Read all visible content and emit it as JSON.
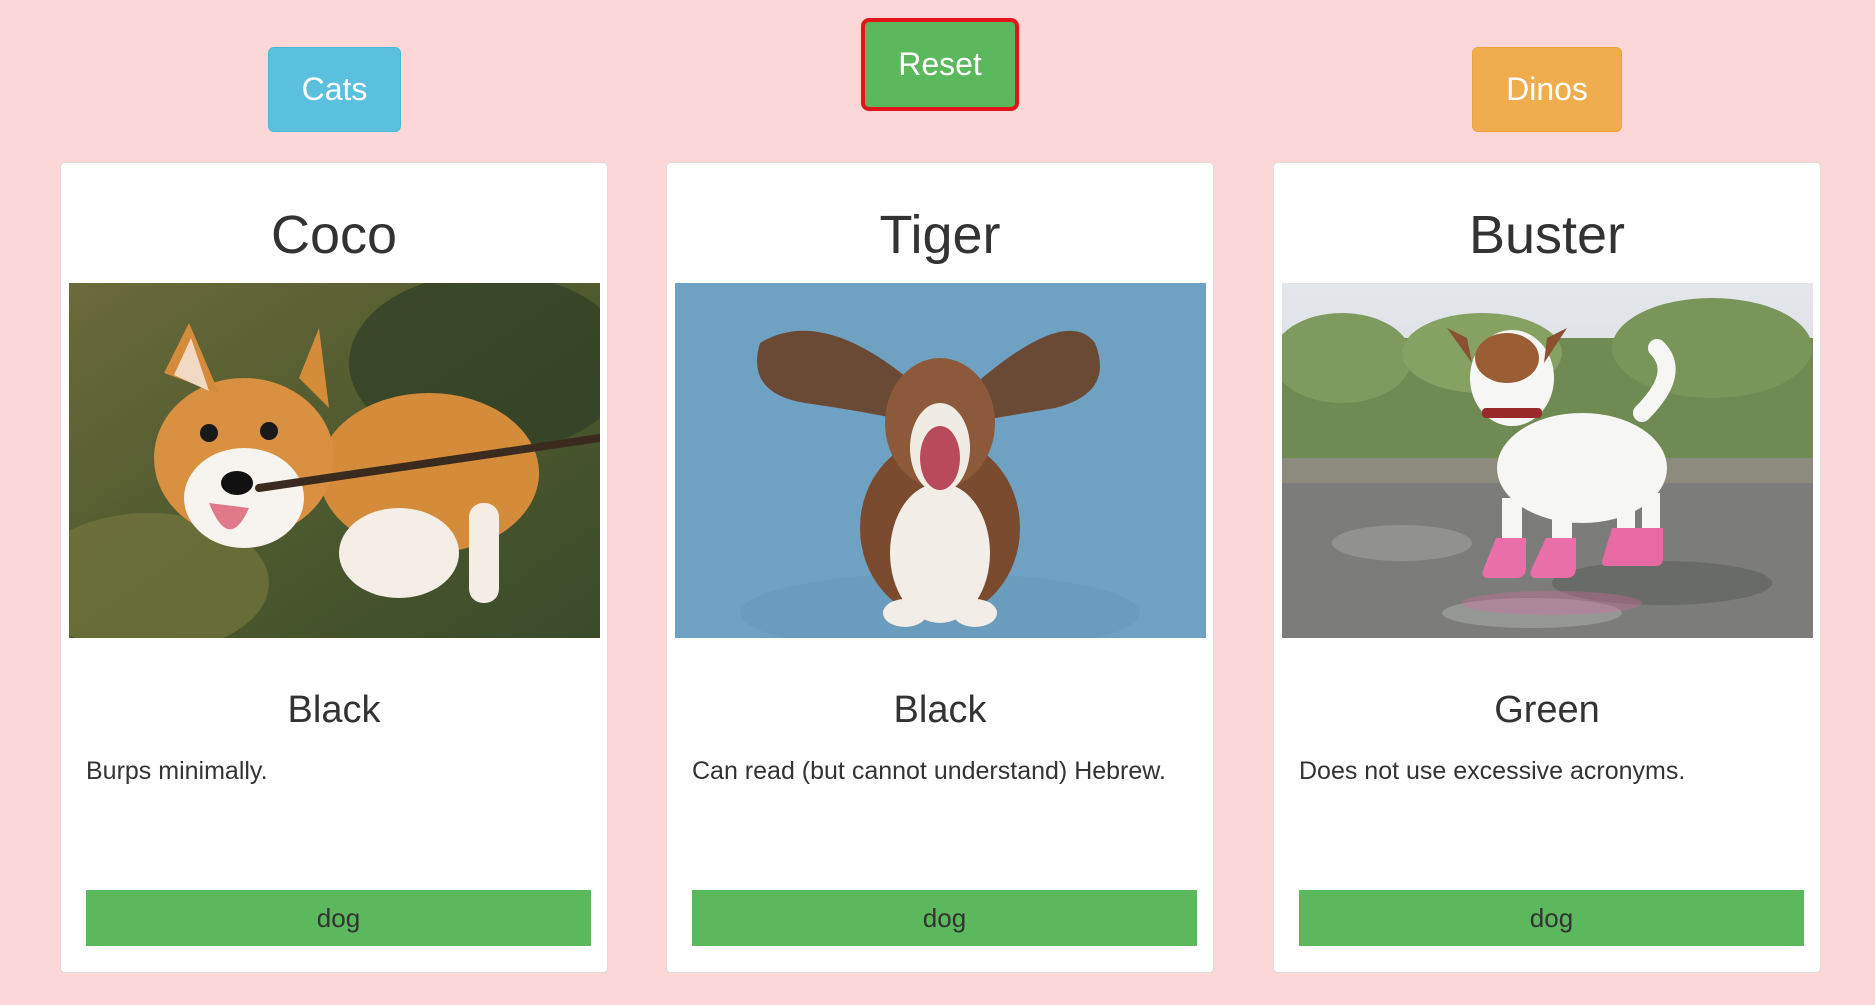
{
  "filters": {
    "cats_label": "Cats",
    "reset_label": "Reset",
    "dinos_label": "Dinos"
  },
  "colors": {
    "background": "#fcd7d8",
    "cats": "#5bc0de",
    "reset": "#5cb85c",
    "reset_border": "#e3141a",
    "dinos": "#f0ad4e",
    "tag": "#5cb85c"
  },
  "cards": [
    {
      "name": "Coco",
      "image": "corgi-with-stick-photo",
      "color": "Black",
      "description": "Burps minimally.",
      "tag": "dog"
    },
    {
      "name": "Tiger",
      "image": "basset-hound-flying-ears-photo",
      "color": "Black",
      "description": "Can read (but cannot understand) Hebrew.",
      "tag": "dog"
    },
    {
      "name": "Buster",
      "image": "terrier-in-pink-boots-photo",
      "color": "Green",
      "description": "Does not use excessive acronyms.",
      "tag": "dog"
    }
  ]
}
